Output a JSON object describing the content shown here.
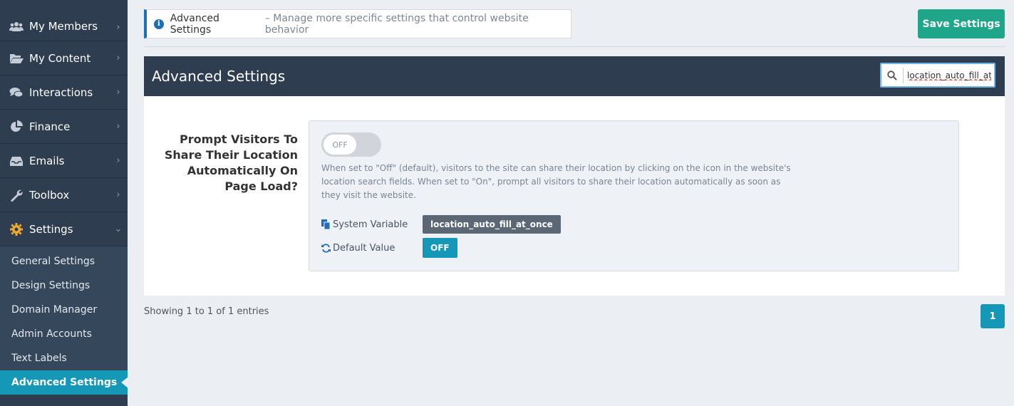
{
  "sidebar": {
    "items": [
      {
        "label": "My Members",
        "icon": "users-icon"
      },
      {
        "label": "My Content",
        "icon": "folder-open-icon"
      },
      {
        "label": "Interactions",
        "icon": "comments-icon"
      },
      {
        "label": "Finance",
        "icon": "pie-chart-icon"
      },
      {
        "label": "Emails",
        "icon": "inbox-icon"
      },
      {
        "label": "Toolbox",
        "icon": "wrench-icon"
      },
      {
        "label": "Settings",
        "icon": "gear-icon"
      }
    ],
    "submenu": [
      "General Settings",
      "Design Settings",
      "Domain Manager",
      "Admin Accounts",
      "Text Labels",
      "Advanced Settings"
    ]
  },
  "banner": {
    "title": "Advanced Settings",
    "description": "– Manage more specific settings that control website behavior"
  },
  "toolbar": {
    "save_label": "Save Settings"
  },
  "panel": {
    "title": "Advanced Settings",
    "search_value": "location_auto_fill_at_once"
  },
  "setting": {
    "label": "Prompt Visitors To Share Their Location Automatically On Page Load?",
    "toggle_state": "OFF",
    "help": "When set to \"Off\" (default), visitors to the site can share their location by clicking on the icon in the website's location search fields. When set to \"On\", prompt all visitors to share their location automatically as soon as they visit the website.",
    "system_variable_label": "System Variable",
    "system_variable": "location_auto_fill_at_once",
    "default_value_label": "Default Value",
    "default_value": "OFF"
  },
  "footer": {
    "showing": "Showing 1 to 1 of 1 entries",
    "page": "1"
  },
  "colors": {
    "sidebar": "#2e3d4f",
    "accent": "#1597b7",
    "save": "#1fa58a"
  }
}
